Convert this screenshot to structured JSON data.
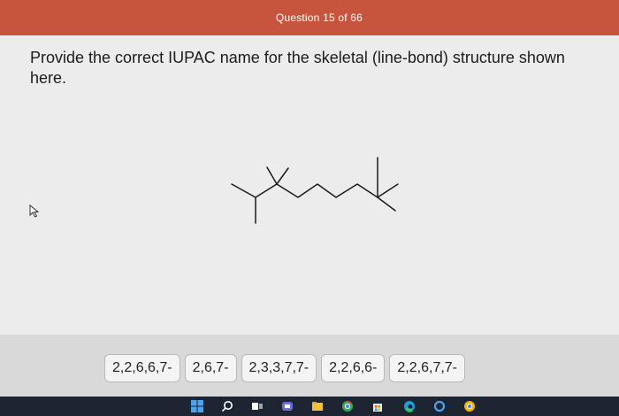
{
  "header": {
    "title": "Question 15 of 66"
  },
  "question": {
    "text": "Provide the correct IUPAC name for the skeletal (line-bond) structure shown here."
  },
  "choices": [
    {
      "label": "2,2,6,6,7-"
    },
    {
      "label": "2,6,7-"
    },
    {
      "label": "2,3,3,7,7-"
    },
    {
      "label": "2,2,6,6-"
    },
    {
      "label": "2,2,6,7,7-"
    }
  ],
  "taskbar": {
    "icons": [
      "windows-icon",
      "search-icon",
      "task-view-icon",
      "teams-icon",
      "file-explorer-icon",
      "chrome-icon",
      "store-icon",
      "edge-icon",
      "cortana-icon",
      "chrome-canary-icon"
    ]
  },
  "colors": {
    "header": "#c7553d",
    "answer_bar": "#d9d9d9",
    "taskbar": "#1d2432"
  }
}
